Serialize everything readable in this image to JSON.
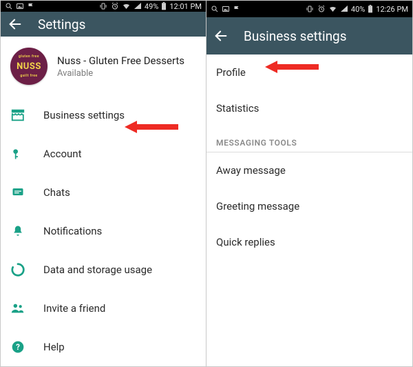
{
  "left": {
    "statusbar": {
      "battery": "49%",
      "time": "12:01 PM"
    },
    "appbar_title": "Settings",
    "profile_name": "Nuss - Gluten Free Desserts",
    "profile_status": "Available",
    "avatar_text": "NUSS",
    "avatar_top": "gluten free",
    "avatar_bottom": "guilt free",
    "items": [
      {
        "label": "Business settings"
      },
      {
        "label": "Account"
      },
      {
        "label": "Chats"
      },
      {
        "label": "Notifications"
      },
      {
        "label": "Data and storage usage"
      },
      {
        "label": "Invite a friend"
      },
      {
        "label": "Help"
      }
    ]
  },
  "right": {
    "statusbar": {
      "battery": "40%",
      "time": "12:26 PM"
    },
    "appbar_title": "Business settings",
    "items_top": [
      {
        "label": "Profile"
      },
      {
        "label": "Statistics"
      }
    ],
    "section_header": "MESSAGING TOOLS",
    "items_tools": [
      {
        "label": "Away message"
      },
      {
        "label": "Greeting message"
      },
      {
        "label": "Quick replies"
      }
    ]
  }
}
